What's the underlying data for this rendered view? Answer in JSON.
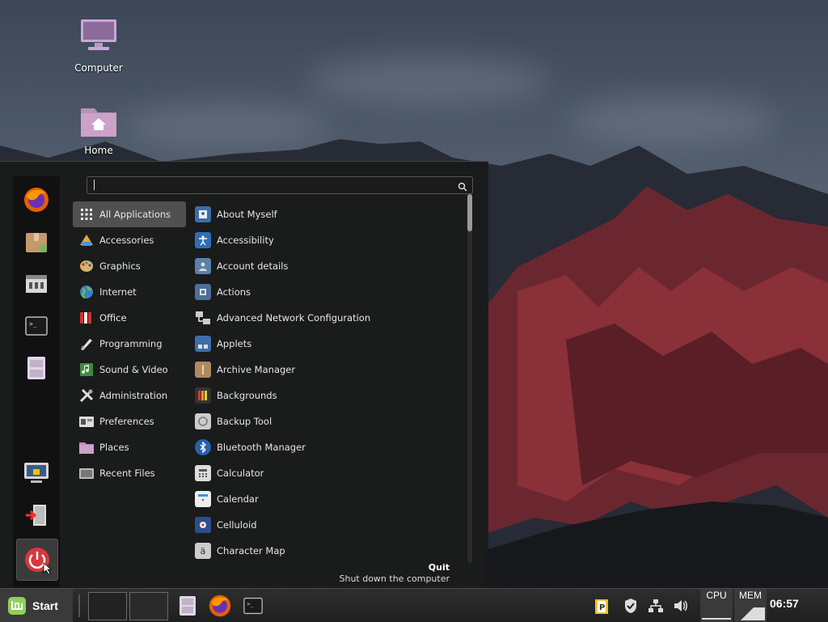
{
  "desktop": {
    "icons": [
      {
        "label": "Computer"
      },
      {
        "label": "Home"
      }
    ]
  },
  "menu": {
    "search": {
      "placeholder": "",
      "value": ""
    },
    "categories": [
      {
        "label": "All Applications",
        "icon": "grid-icon",
        "selected": true
      },
      {
        "label": "Accessories",
        "icon": "accessories-icon"
      },
      {
        "label": "Graphics",
        "icon": "graphics-icon"
      },
      {
        "label": "Internet",
        "icon": "internet-icon"
      },
      {
        "label": "Office",
        "icon": "office-icon"
      },
      {
        "label": "Programming",
        "icon": "programming-icon"
      },
      {
        "label": "Sound & Video",
        "icon": "sound-video-icon"
      },
      {
        "label": "Administration",
        "icon": "administration-icon"
      },
      {
        "label": "Preferences",
        "icon": "preferences-icon"
      },
      {
        "label": "Places",
        "icon": "folder-icon"
      },
      {
        "label": "Recent Files",
        "icon": "recent-files-icon"
      }
    ],
    "apps": [
      {
        "label": "About Myself",
        "icon": "about-myself-icon"
      },
      {
        "label": "Accessibility",
        "icon": "accessibility-icon"
      },
      {
        "label": "Account details",
        "icon": "account-details-icon"
      },
      {
        "label": "Actions",
        "icon": "actions-icon"
      },
      {
        "label": "Advanced Network Configuration",
        "icon": "network-config-icon"
      },
      {
        "label": "Applets",
        "icon": "applets-icon"
      },
      {
        "label": "Archive Manager",
        "icon": "archive-manager-icon"
      },
      {
        "label": "Backgrounds",
        "icon": "backgrounds-icon"
      },
      {
        "label": "Backup Tool",
        "icon": "backup-tool-icon"
      },
      {
        "label": "Bluetooth Manager",
        "icon": "bluetooth-icon"
      },
      {
        "label": "Calculator",
        "icon": "calculator-icon"
      },
      {
        "label": "Calendar",
        "icon": "calendar-icon"
      },
      {
        "label": "Celluloid",
        "icon": "celluloid-icon"
      },
      {
        "label": "Character Map",
        "icon": "character-map-icon"
      }
    ],
    "quit": {
      "title": "Quit",
      "description": "Shut down the computer"
    }
  },
  "taskbar": {
    "start_label": "Start",
    "cpu_label": "CPU",
    "mem_label": "MEM",
    "clock": "06:57"
  }
}
